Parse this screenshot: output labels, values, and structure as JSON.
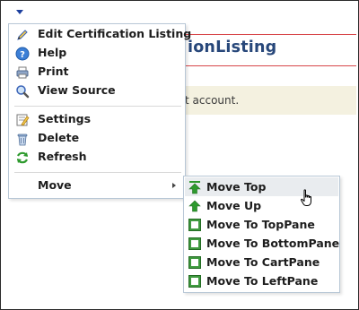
{
  "page": {
    "title": "ionListing",
    "info_text": "t account."
  },
  "menu": {
    "items": [
      {
        "label": "Edit Certification Listing",
        "icon": "pencil-icon"
      },
      {
        "label": "Help",
        "icon": "help-icon"
      },
      {
        "label": "Print",
        "icon": "printer-icon"
      },
      {
        "label": "View Source",
        "icon": "magnifier-icon"
      },
      {
        "label": "Settings",
        "icon": "settings-icon"
      },
      {
        "label": "Delete",
        "icon": "trash-icon"
      },
      {
        "label": "Refresh",
        "icon": "refresh-icon"
      },
      {
        "label": "Move",
        "icon": "submenu-arrow-icon"
      }
    ]
  },
  "submenu": {
    "items": [
      {
        "label": "Move Top",
        "icon": "move-top-icon"
      },
      {
        "label": "Move Up",
        "icon": "move-up-icon"
      },
      {
        "label": "Move To TopPane",
        "icon": "pane-icon"
      },
      {
        "label": "Move To BottomPane",
        "icon": "pane-icon"
      },
      {
        "label": "Move To CartPane",
        "icon": "pane-icon"
      },
      {
        "label": "Move To LeftPane",
        "icon": "pane-icon"
      }
    ]
  },
  "colors": {
    "title": "#27477a",
    "rule": "#d8464a",
    "info_band": "#f4f1e0",
    "hover": "#e9ecef",
    "menu_border": "#b8c7d6"
  }
}
